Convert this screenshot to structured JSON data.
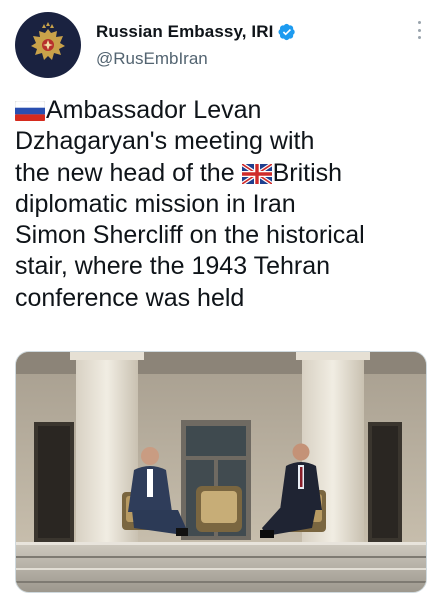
{
  "account": {
    "display_name": "Russian Embassy, IRI",
    "handle": "@RusEmbIran",
    "verified": true,
    "avatar_icon": "russian-coat-of-arms-icon"
  },
  "tweet": {
    "lines": [
      "Ambassador Levan",
      "Dzhagaryan's meeting with",
      "the new head of the ",
      "diplomatic mission in Iran",
      "Simon Shercliff on the historical",
      "stair, where the 1943 Tehran",
      "conference was held"
    ],
    "line3_suffix": "British"
  },
  "colors": {
    "verified_blue": "#1d9bf0",
    "text": "#0f1419",
    "secondary": "#536471"
  },
  "icons": {
    "more": "more-vertical-icon",
    "russia_flag": "russia-flag-icon",
    "uk_flag": "uk-flag-icon"
  }
}
